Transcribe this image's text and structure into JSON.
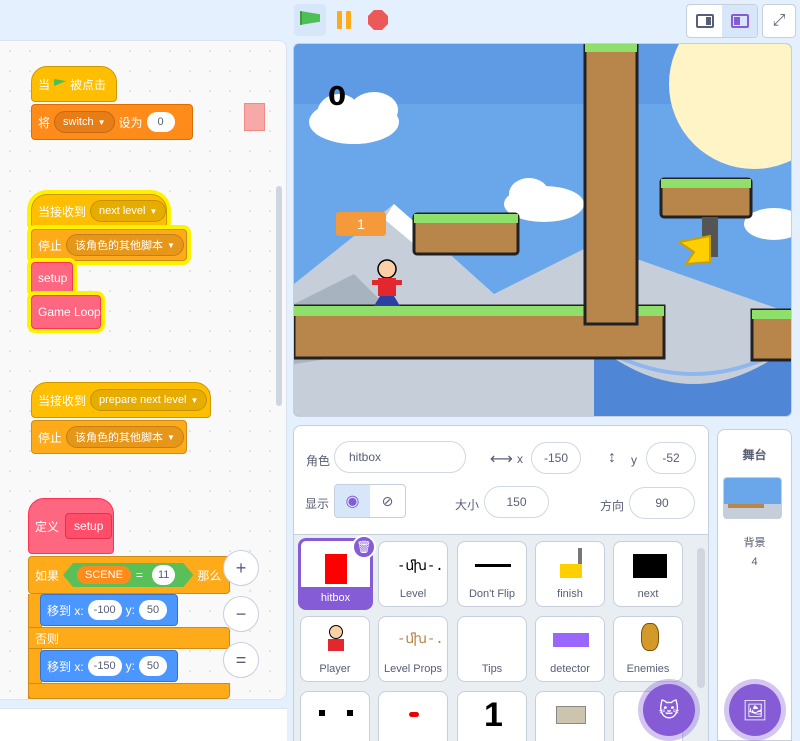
{
  "scripts": {
    "s1": {
      "hat": "当",
      "hat_suffix": "被点击",
      "set_prefix": "将",
      "set_var": "switch",
      "set_mid": "设为",
      "set_val": "0"
    },
    "s2": {
      "hat": "当接收到",
      "msg": "next level",
      "stop": "停止",
      "stop_opt": "该角色的其他脚本",
      "call1": "setup",
      "call2": "Game Loop"
    },
    "s3": {
      "hat": "当接收到",
      "msg": "prepare next level",
      "stop": "停止",
      "stop_opt": "该角色的其他脚本"
    },
    "s4": {
      "define": "定义",
      "name": "setup",
      "if": "如果",
      "var": "SCENE",
      "eq": "=",
      "val": "11",
      "then": "那么",
      "move": "移到 x:",
      "x1": "-100",
      "y_lbl": "y:",
      "y1": "50",
      "else": "否则",
      "x2": "-150",
      "y2": "50"
    }
  },
  "zoom": {
    "in": "+",
    "out": "−",
    "reset": "="
  },
  "stage": {
    "score": "0",
    "level": "1"
  },
  "sprite_info": {
    "sprite_label": "角色",
    "sprite_name": "hitbox",
    "x_label": "x",
    "x_value": "-150",
    "y_label": "y",
    "y_value": "-52",
    "show_label": "显示",
    "size_label": "大小",
    "size_value": "150",
    "direction_label": "方向",
    "direction_value": "90"
  },
  "sprites": [
    "hitbox",
    "Level",
    "Don't Flip",
    "finish",
    "next",
    "Player",
    "Level Props",
    "Tips",
    "detector",
    "Enemies"
  ],
  "stage_panel": {
    "title": "舞台",
    "backdrop_label": "背景",
    "backdrop_count": "4"
  },
  "colors": {
    "accent": "#855cd6",
    "events": "#ffbf00",
    "control": "#ffab19",
    "motion": "#4c97ff",
    "operators": "#59c059",
    "custom": "#ff6680"
  }
}
